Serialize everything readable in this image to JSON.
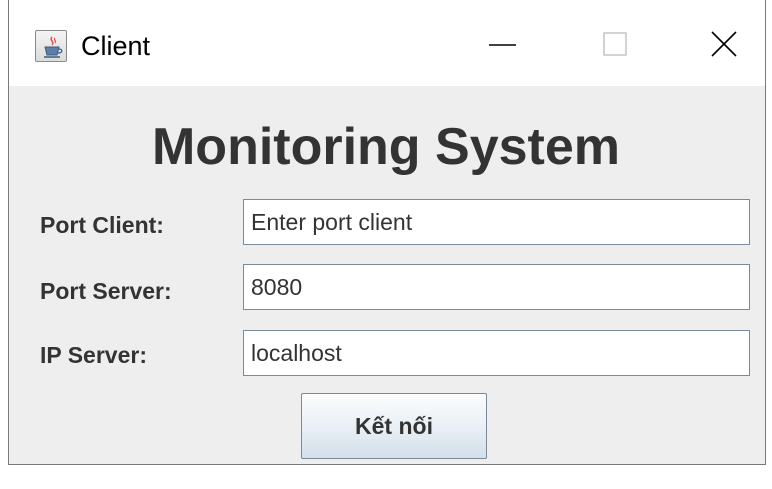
{
  "window": {
    "title": "Client",
    "icon": "java-cup-icon",
    "controls": {
      "minimize": "minimize-icon",
      "maximize": "maximize-icon",
      "close": "close-icon"
    }
  },
  "main": {
    "heading": "Monitoring System",
    "fields": [
      {
        "label": "Port Client:",
        "value": "",
        "placeholder": "Enter port client"
      },
      {
        "label": "Port Server:",
        "value": "8080",
        "placeholder": ""
      },
      {
        "label": "IP Server:",
        "value": "localhost",
        "placeholder": ""
      }
    ],
    "connect_label": "Kết nối"
  },
  "colors": {
    "text": "#333333",
    "panel_background": "#eeeeee",
    "field_border": "#7a8a99"
  }
}
